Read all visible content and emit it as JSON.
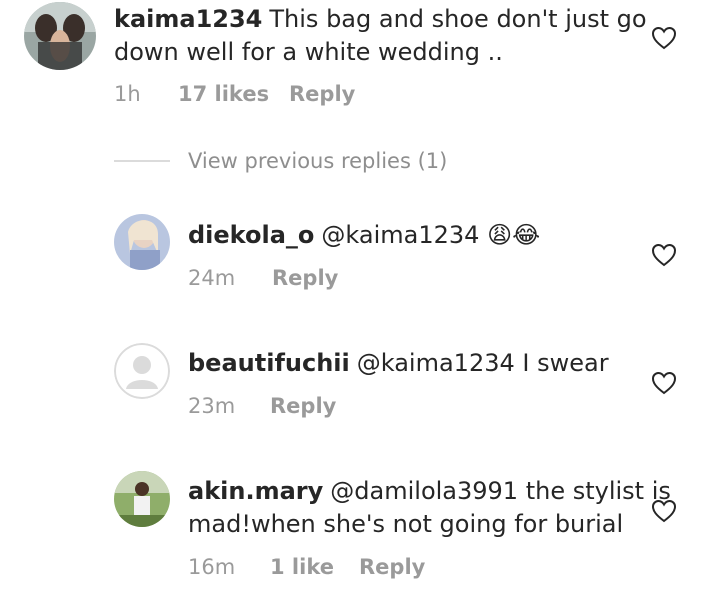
{
  "comment": {
    "username": "kaima1234",
    "text_line1": "This bag and shoe don't just go",
    "text_line2": "down well for a white wedding ..",
    "time": "1h",
    "likes": "17 likes",
    "reply": "Reply"
  },
  "view_previous_replies": "View previous replies (1)",
  "replies": [
    {
      "username": "diekola_o",
      "text": "@kaima1234",
      "emojis": "😩😂",
      "time": "24m",
      "reply": "Reply"
    },
    {
      "username": "beautifuchii",
      "text": "@kaima1234 I swear",
      "time": "23m",
      "reply": "Reply"
    },
    {
      "username": "akin.mary",
      "text_line1": "@damilola3991 the stylist is",
      "text_line2": "mad!when she's not going for burial",
      "time": "16m",
      "likes": "1 like",
      "reply": "Reply"
    }
  ],
  "icons": {
    "like": "heart-outline-icon",
    "default_avatar": "default-avatar-icon"
  },
  "colors": {
    "text": "#262626",
    "meta": "#9a9a9a",
    "divider": "#dbdbdb"
  }
}
